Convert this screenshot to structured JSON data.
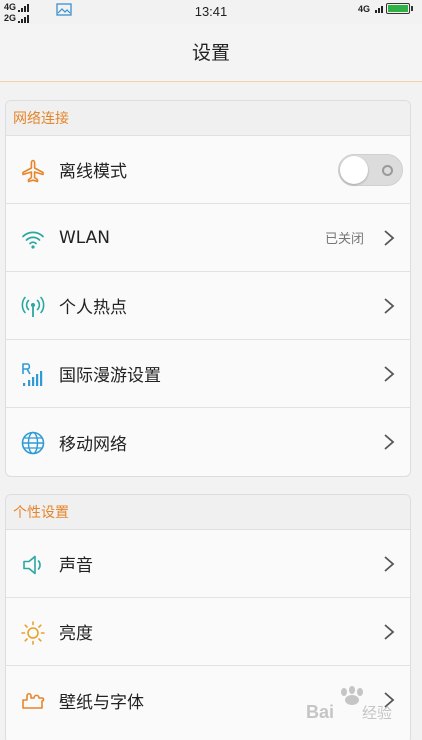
{
  "status_bar": {
    "sim1_network": "4G",
    "sim2_network": "2G",
    "time": "13:41",
    "right_network": "4G",
    "battery_level": 1.0
  },
  "title": "设置",
  "sections": [
    {
      "header": "网络连接",
      "items": [
        {
          "label": "离线模式",
          "icon": "airplane-icon",
          "control": "toggle",
          "toggle_on": false
        },
        {
          "label": "WLAN",
          "icon": "wifi-icon",
          "value": "已关闭"
        },
        {
          "label": "个人热点",
          "icon": "hotspot-icon"
        },
        {
          "label": "国际漫游设置",
          "icon": "roaming-icon"
        },
        {
          "label": "移动网络",
          "icon": "globe-icon"
        }
      ]
    },
    {
      "header": "个性设置",
      "items": [
        {
          "label": "声音",
          "icon": "speaker-icon"
        },
        {
          "label": "亮度",
          "icon": "brightness-icon"
        },
        {
          "label": "壁纸与字体",
          "icon": "wallpaper-icon"
        }
      ]
    }
  ],
  "watermark": "Baidu经验",
  "colors": {
    "accent": "#e5852a",
    "icon_teal": "#2aa7a0",
    "icon_orange": "#e8842a",
    "icon_blue": "#2f9ad6",
    "battery_green": "#2fb144"
  }
}
